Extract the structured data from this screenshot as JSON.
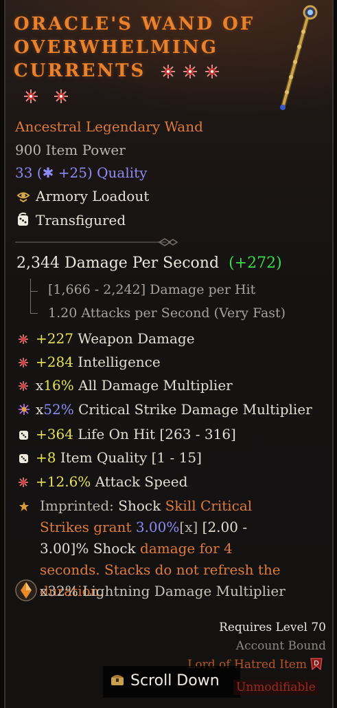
{
  "item": {
    "title": "Oracle's Wand of Overwhelming Currents",
    "type": "Ancestral Legendary Wand",
    "item_power": "900 Item Power",
    "quality_base": "33 (",
    "quality_bonus": "+25",
    "quality_suffix": ") Quality",
    "armory": "Armory Loadout",
    "transfigured": "Transfigured",
    "sockets_row1": 3,
    "sockets_row2": 2
  },
  "stats": {
    "dps_value": "2,344 Damage Per Second",
    "dps_change": "(+272)",
    "damage_per_hit": "[1,666 - 2,242] Damage per Hit",
    "attacks_per_second": "1.20 Attacks per Second (Very Fast)"
  },
  "affixes": [
    {
      "value": "+227",
      "text": " Weapon Damage",
      "icon": "red-rune-icon"
    },
    {
      "value": "+284",
      "text": " Intelligence",
      "icon": "red-rune-icon"
    },
    {
      "prefix": "x",
      "value": "16%",
      "text": " All Damage Multiplier",
      "icon": "red-rune-icon"
    },
    {
      "prefix": "x",
      "value": "52%",
      "text": " Critical Strike Damage Multiplier",
      "icon": "purple-rune-icon"
    },
    {
      "value": "+364",
      "text": " Life On Hit [263 - 316]",
      "icon": "dice-icon"
    },
    {
      "value": "+8",
      "text": " Item Quality [1 - 15]",
      "icon": "dice-icon"
    },
    {
      "value": "+12.6%",
      "text": " Attack Speed",
      "icon": "red-rune-icon"
    }
  ],
  "imprint": {
    "label": "Imprinted: ",
    "skill": "Shock",
    "t1": " Skill Critical Strikes grant ",
    "pct": "3.00%",
    "tag": "[x]",
    "range": " [2.00 - 3.00]% ",
    "skill2": "Shock",
    "t2": " damage for 4 seconds. Stacks do not refresh the duration."
  },
  "gem_affix": "x32% Lightning Damage Multiplier",
  "footer": {
    "requires": "Requires Level 70",
    "bound": "Account Bound",
    "expansion": "Lord of Hatred Item",
    "unmodifiable": "Unmodifiable",
    "scroll": "Scroll Down"
  },
  "colors": {
    "title": "#e8822c",
    "legendary": "#e07b3a",
    "blue": "#8f8cf5",
    "green": "#3ddc4a",
    "yellow": "#e6e25a"
  }
}
